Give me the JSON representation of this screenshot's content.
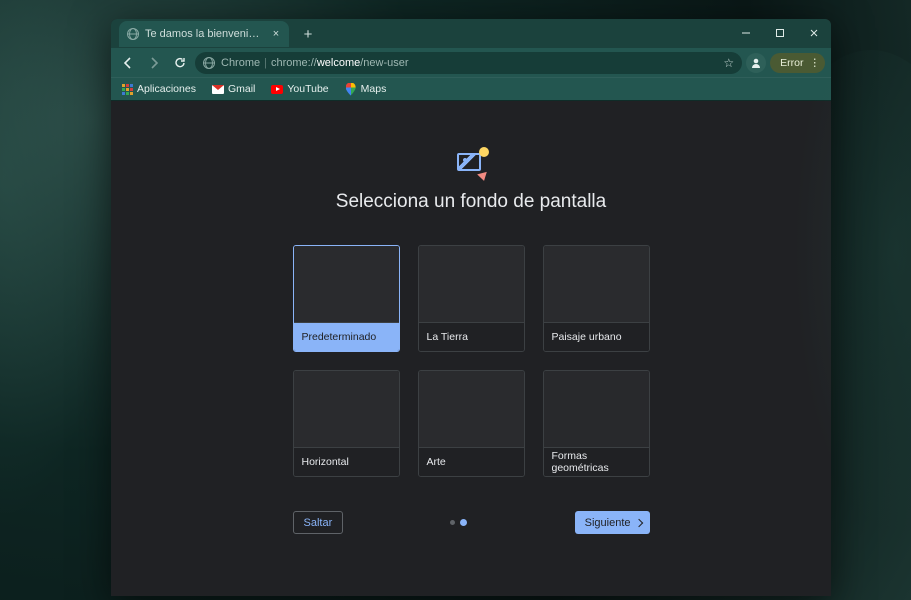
{
  "titlebar": {
    "tab_title": "Te damos la bienvenida a Chrome"
  },
  "toolbar": {
    "omnibox_prefix": "Chrome",
    "omnibox_url_pre": "chrome://",
    "omnibox_url_bold": "welcome",
    "omnibox_url_post": "/new-user",
    "error_label": "Error"
  },
  "bookmarks": {
    "items": [
      {
        "label": "Aplicaciones"
      },
      {
        "label": "Gmail"
      },
      {
        "label": "YouTube"
      },
      {
        "label": "Maps"
      }
    ]
  },
  "content": {
    "headline": "Selecciona un fondo de pantalla",
    "cards": [
      {
        "label": "Predeterminado",
        "selected": true,
        "thumb": "default"
      },
      {
        "label": "La Tierra",
        "selected": false,
        "thumb": "earth"
      },
      {
        "label": "Paisaje urbano",
        "selected": false,
        "thumb": "urban"
      },
      {
        "label": "Horizontal",
        "selected": false,
        "thumb": "landscape"
      },
      {
        "label": "Arte",
        "selected": false,
        "thumb": "art"
      },
      {
        "label": "Formas geométricas",
        "selected": false,
        "thumb": "geo"
      }
    ],
    "skip_label": "Saltar",
    "next_label": "Siguiente",
    "step_active_index": 1,
    "step_count": 2
  }
}
